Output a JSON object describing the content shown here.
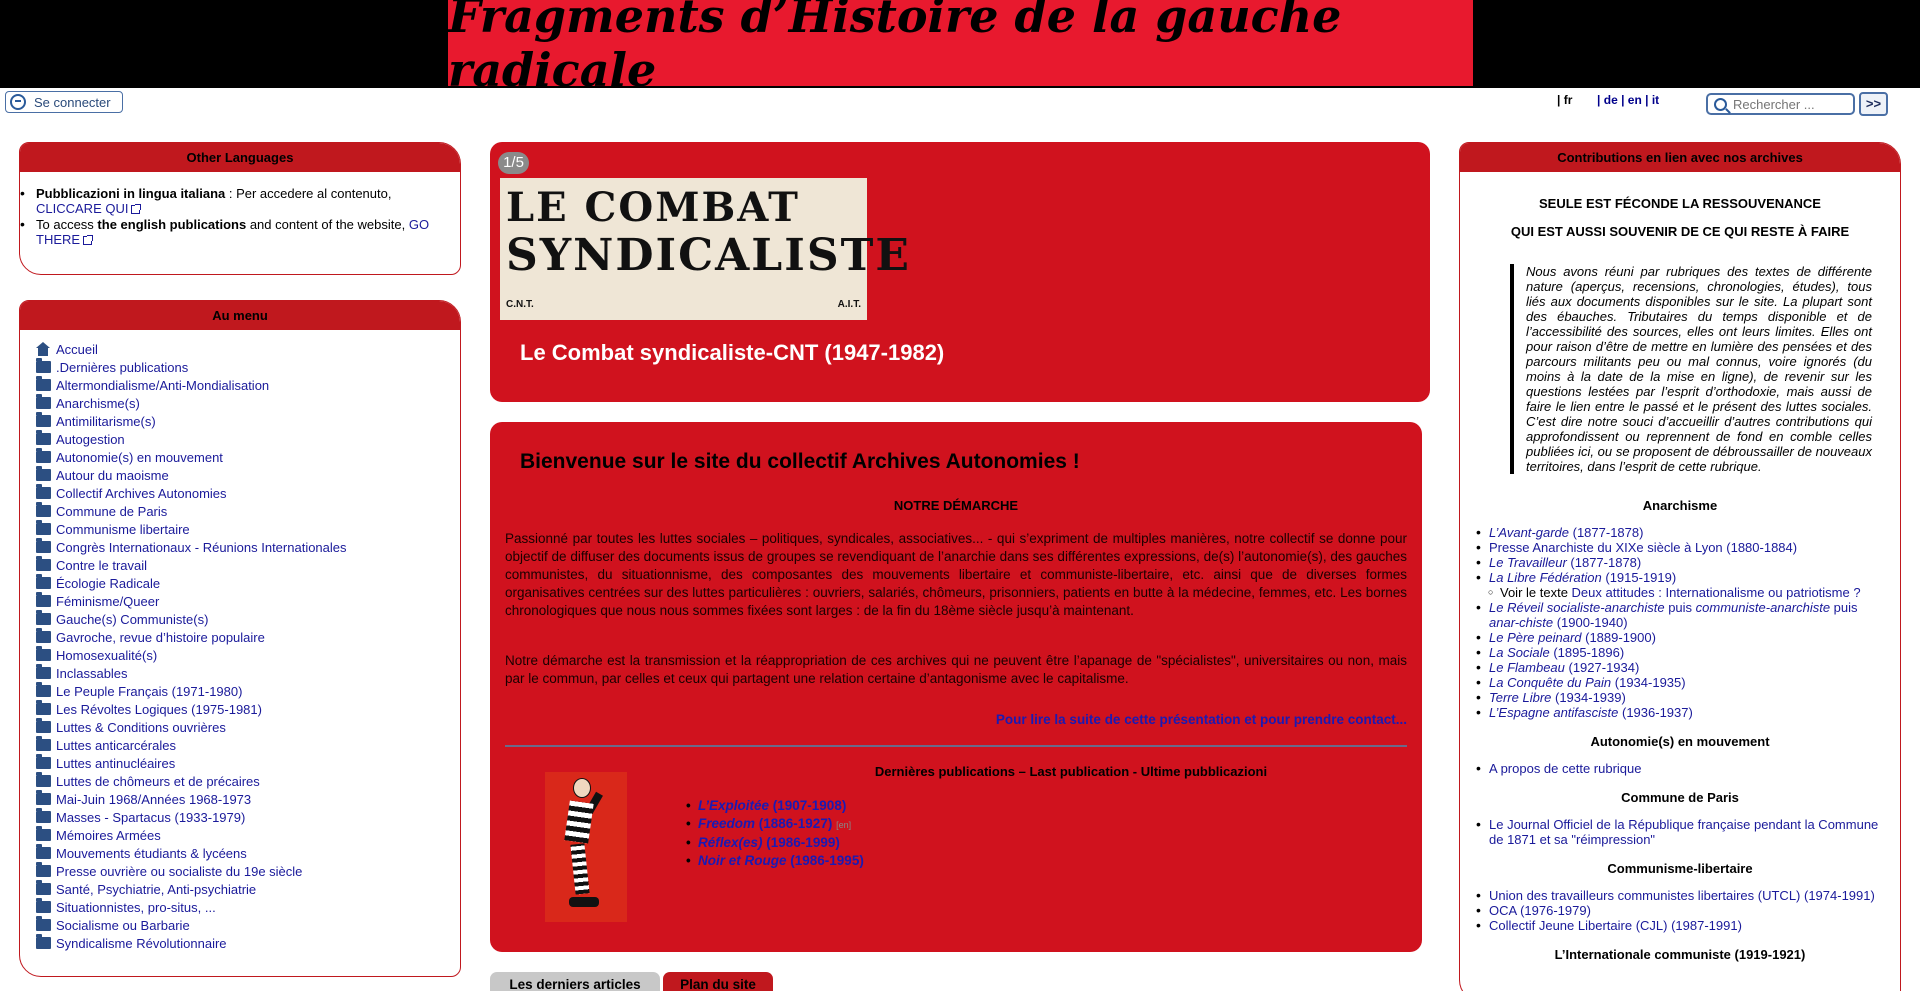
{
  "header": {
    "title": "Fragments d’Histoire de la gauche radicale"
  },
  "login": {
    "label": "Se connecter"
  },
  "languages": {
    "current": "| fr",
    "others": [
      "| de",
      "| en",
      "| it"
    ]
  },
  "search": {
    "placeholder": "Rechercher ...",
    "button": ">>"
  },
  "other_languages": {
    "title": "Other Languages",
    "item1_bold": "Pubblicazioni in lingua italiana",
    "item1_text": " : Per accedere al contenuto, ",
    "item1_link": "CLICCARE QUI",
    "item2_pre": "To access ",
    "item2_bold": "the english publications",
    "item2_text": " and content of the website, ",
    "item2_link": "GO THERE"
  },
  "menu": {
    "title": "Au menu",
    "items": [
      "Accueil",
      ".Dernières publications",
      "Altermondialisme/Anti-Mondialisation",
      "Anarchisme(s)",
      "Antimilitarisme(s)",
      "Autogestion",
      "Autonomie(s) en mouvement",
      "Autour du maoisme",
      "Collectif Archives Autonomies",
      "Commune de Paris",
      "Communisme libertaire",
      "Congrès Internationaux - Réunions Internationales",
      "Contre le travail",
      "Écologie Radicale",
      "Féminisme/Queer",
      "Gauche(s) Communiste(s)",
      "Gavroche, revue d’histoire populaire",
      "Homosexualité(s)",
      "Inclassables",
      "Le Peuple Français (1971-1980)",
      "Les Révoltes Logiques (1975-1981)",
      "Luttes & Conditions ouvrières",
      "Luttes anticarcérales",
      "Luttes antinucléaires",
      "Luttes de chômeurs et de précaires",
      "Mai-Juin 1968/Années 1968-1973",
      "Masses - Spartacus (1933-1979)",
      "Mémoires Armées",
      "Mouvements étudiants & lycéens",
      "Presse ouvrière ou socialiste du 19e siècle",
      "Santé, Psychiatrie, Anti-psychiatrie",
      "Situationnistes, pro-situs, ...",
      "Socialisme ou Barbarie",
      "Syndicalisme Révolutionnaire"
    ]
  },
  "slideshow": {
    "counter": "1/5",
    "caption": "Le Combat syndicaliste-CNT (1947-1982)",
    "image": {
      "headline1": "LE COMBAT",
      "headline2": "SYNDICALISTE",
      "left_mark": "C.N.T.",
      "right_mark": "A.I.T."
    }
  },
  "welcome": {
    "title": "Bienvenue sur le site du collectif Archives Autonomies !",
    "subtitle": "NOTRE DÉMARCHE",
    "paragraph1": "Passionné par toutes les luttes sociales – politiques, syndicales, associatives... - qui s’expriment de multiples manières, notre collectif se donne pour objectif de diffuser des documents issus de groupes se revendiquant de l’anarchie dans ses différentes expressions, de(s) l’autonomie(s), des gauches communistes, du situationnisme, des composantes des mouvements libertaire et communiste-libertaire, etc. ainsi que de diverses formes organisatives centrées sur des luttes particulières : ouvriers, salariés, chômeurs, prisonniers, patients en butte à la médecine, femmes, etc. Les bornes chronologiques que nous nous sommes fixées sont larges : de la fin du 18ème siècle jusqu’à maintenant.",
    "paragraph2": "Notre démarche est la transmission et la réappropriation de ces archives qui ne peuvent être l’apanage de \"spécialistes\", universitaires ou non, mais par le commun, par celles et ceux qui partagent une relation certaine d’antagonisme avec le capitalisme.",
    "more_link": "Pour lire la suite de cette présentation et pour prendre contact...",
    "publications_title": "Dernières publications – Last publication - Ultime pubblicazioni",
    "publications": [
      {
        "title": "L’Exploitée",
        "years": " (1907-1908)",
        "tag": ""
      },
      {
        "title": "Freedom",
        "years": " (1886-1927)",
        "tag": "[en]"
      },
      {
        "title": "Réflex(es)",
        "years": " (1986-1999)",
        "tag": ""
      },
      {
        "title": "Noir et Rouge",
        "years": " (1986-1995)",
        "tag": ""
      }
    ]
  },
  "tabs": [
    "Les derniers articles",
    "Plan du site"
  ],
  "contributions": {
    "title": "Contributions en lien avec nos archives",
    "line1": "SEULE EST FÉCONDE LA RESSOUVENANCE",
    "line2": "QUI EST AUSSI SOUVENIR DE CE QUI RESTE À FAIRE",
    "quote": "Nous avons réuni par rubriques des textes de différente nature (aperçus, recensions, chronologies, études), tous liés aux documents disponibles sur le site. La plupart sont des ébauches. Tributaires du temps disponible et de l’accessibilité des sources, elles ont leurs limites. Elles ont pour raison d’être de mettre en lumière des pensées et des parcours militants peu ou mal connus, voire ignorés (du moins à la date de la mise en ligne), de revenir sur les questions lestées par l’esprit d’orthodoxie, mais aussi de faire le lien entre le passé et le présent des luttes sociales. C’est dire notre souci d’accueillir d’autres contributions qui approfondissent ou reprennent de fond en comble celles publiées ici, ou se proposent de débroussailler de nouveaux territoires, dans l’esprit de cette rubrique.",
    "sections": {
      "anarchisme": {
        "title": "Anarchisme",
        "items": [
          {
            "title": "L’Avant-garde",
            "rest": " (1877-1878)"
          },
          {
            "title": "",
            "rest": "Presse Anarchiste du XIXe siècle à Lyon (1880-1884)"
          },
          {
            "title": "Le Travailleur",
            "rest": " (1877-1878)"
          },
          {
            "title": "La Libre Fédération",
            "rest": " (1915-1919)"
          }
        ],
        "sub_pre": "Voir le texte ",
        "sub_link": "Deux attitudes : Internationalisme ou patriotisme ?",
        "items2": [
          {
            "title": "Le Réveil socialiste-anarchiste",
            "rest": " puis ",
            "title2": "communiste-anarchiste",
            "rest2": " puis ",
            "title3": "anar-chiste",
            "rest3": " (1900-1940)"
          },
          {
            "title": "Le Père peinard",
            "rest": " (1889-1900)"
          },
          {
            "title": "La Sociale",
            "rest": " (1895-1896)"
          },
          {
            "title": "Le Flambeau",
            "rest": " (1927-1934)"
          },
          {
            "title": "La Conquête du Pain",
            "rest": " (1934-1935)"
          },
          {
            "title": "Terre Libre",
            "rest": " (1934-1939)"
          },
          {
            "title": "L’Espagne antifasciste",
            "rest": " (1936-1937)"
          }
        ]
      },
      "autonomie": {
        "title": "Autonomie(s) en mouvement",
        "items": [
          "A propos de cette rubrique"
        ]
      },
      "commune": {
        "title": "Commune de Paris",
        "items": [
          "Le Journal Officiel de la République française pendant la Commune de 1871 et sa \"réimpression\""
        ]
      },
      "communisme": {
        "title": "Communisme-libertaire",
        "items": [
          "Union des travailleurs communistes libertaires (UTCL) (1974-1991)",
          "OCA (1976-1979)",
          "Collectif Jeune Libertaire (CJL) (1987-1991)"
        ]
      },
      "internationale": {
        "title": "L’Internationale communiste (1919-1921)"
      }
    }
  }
}
